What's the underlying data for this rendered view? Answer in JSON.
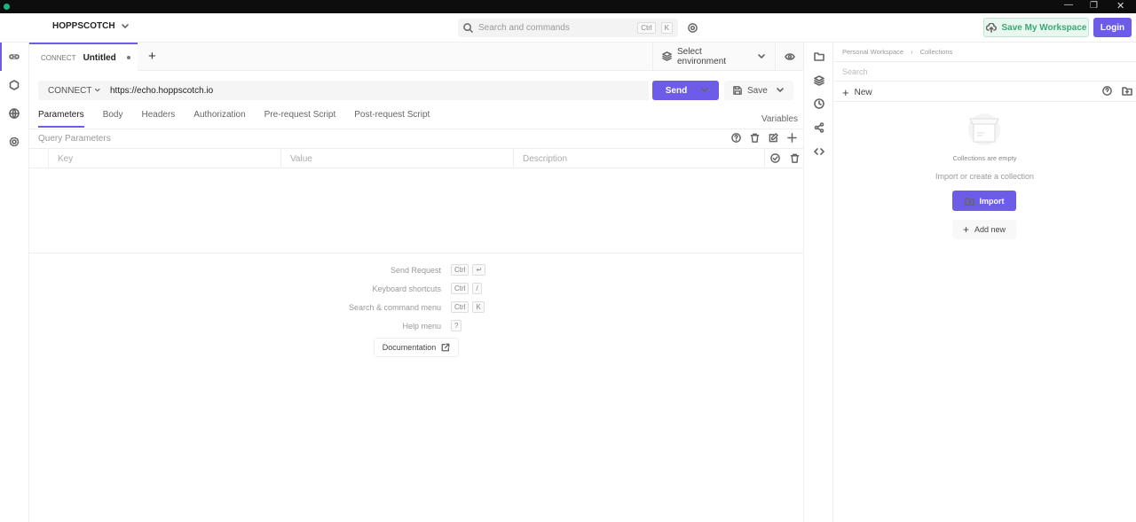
{
  "app": {
    "workspace_name": "HOPPSCOTCH",
    "search_placeholder": "Search and commands",
    "search_kbd": [
      "Ctrl",
      "K"
    ],
    "save_workspace": "Save My Workspace",
    "login": "Login"
  },
  "request_tab": {
    "method": "CONNECT",
    "title": "Untitled"
  },
  "environment": {
    "label": "Select environment"
  },
  "request": {
    "method": "CONNECT",
    "url": "https://echo.hoppscotch.io",
    "send": "Send",
    "save": "Save"
  },
  "tabs": [
    "Parameters",
    "Body",
    "Headers",
    "Authorization",
    "Pre-request Script",
    "Post-request Script"
  ],
  "variables": "Variables",
  "query": {
    "title": "Query Parameters",
    "key": "Key",
    "value": "Value",
    "description": "Description"
  },
  "shortcuts": [
    {
      "label": "Send Request",
      "keys": [
        "Ctrl",
        "↵"
      ]
    },
    {
      "label": "Keyboard shortcuts",
      "keys": [
        "Ctrl",
        "/"
      ]
    },
    {
      "label": "Search & command menu",
      "keys": [
        "Ctrl",
        "K"
      ]
    },
    {
      "label": "Help menu",
      "keys": [
        "?"
      ]
    }
  ],
  "documentation": "Documentation",
  "collections": {
    "breadcrumb": [
      "Personal Workspace",
      "Collections"
    ],
    "search_placeholder": "Search",
    "new": "New",
    "empty": "Collections are empty",
    "hint": "Import or create a collection",
    "import": "Import",
    "add_new": "Add new"
  },
  "colors": {
    "accent": "#6c5ce7",
    "green": "#3cb371",
    "red": "#e05555"
  }
}
